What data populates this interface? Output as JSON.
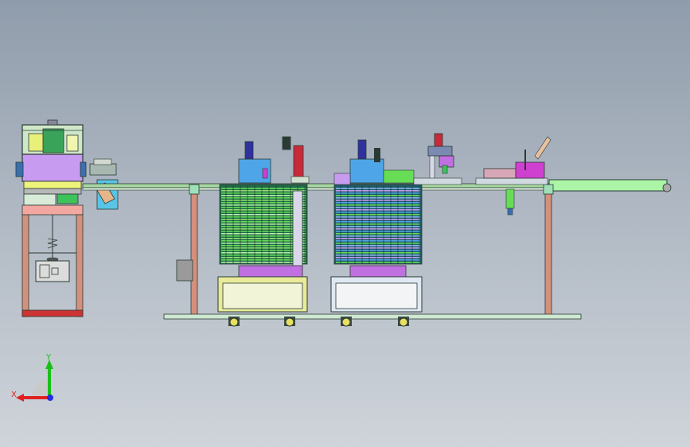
{
  "triad": {
    "x_label": "X",
    "y_label": "Y",
    "x_color": "#e02020",
    "y_color": "#18c018",
    "z_color": "#2030e0"
  },
  "colors": {
    "background_top": "#8f9cab",
    "background_bottom": "#cfd4da",
    "frame": "#2a3a34",
    "post_salmon": "#d4907c",
    "conveyor": "#a7d7a2",
    "magazine_green": "#66dd55",
    "magazine_blue": "#4ea6e8",
    "accent_purple": "#c79cf0",
    "accent_magenta": "#d040d0",
    "accent_red": "#c82a3a"
  }
}
